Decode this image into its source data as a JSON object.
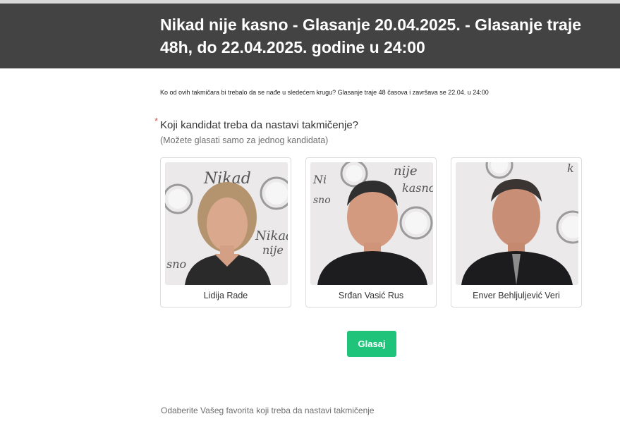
{
  "header": {
    "title": "Nikad nije kasno - Glasanje 20.04.2025. - Glasanje traje 48h, do 22.04.2025. godine u 24:00"
  },
  "description": "Ko od ovih takmičara bi trebalo da se nađe u sledećem krugu? Glasanje traje 48 časova i završava se 22.04. u 24:00",
  "question": {
    "required_mark": "*",
    "label": "Koji kandidat treba da nastavi takmičenje?",
    "hint": "(Možete glasati samo za jednog kandidata)"
  },
  "candidates": [
    {
      "name": "Lidija Rade"
    },
    {
      "name": "Srđan Vasić Rus"
    },
    {
      "name": "Enver Behljuljević Veri"
    }
  ],
  "vote_button": {
    "label": "Glasaj"
  },
  "footer": {
    "text": "Odaberite Vašeg favorita koji treba da nastavi takmičenje"
  },
  "colors": {
    "header_bg": "#434343",
    "button_bg": "#1fc47a",
    "required": "#d9534f"
  }
}
